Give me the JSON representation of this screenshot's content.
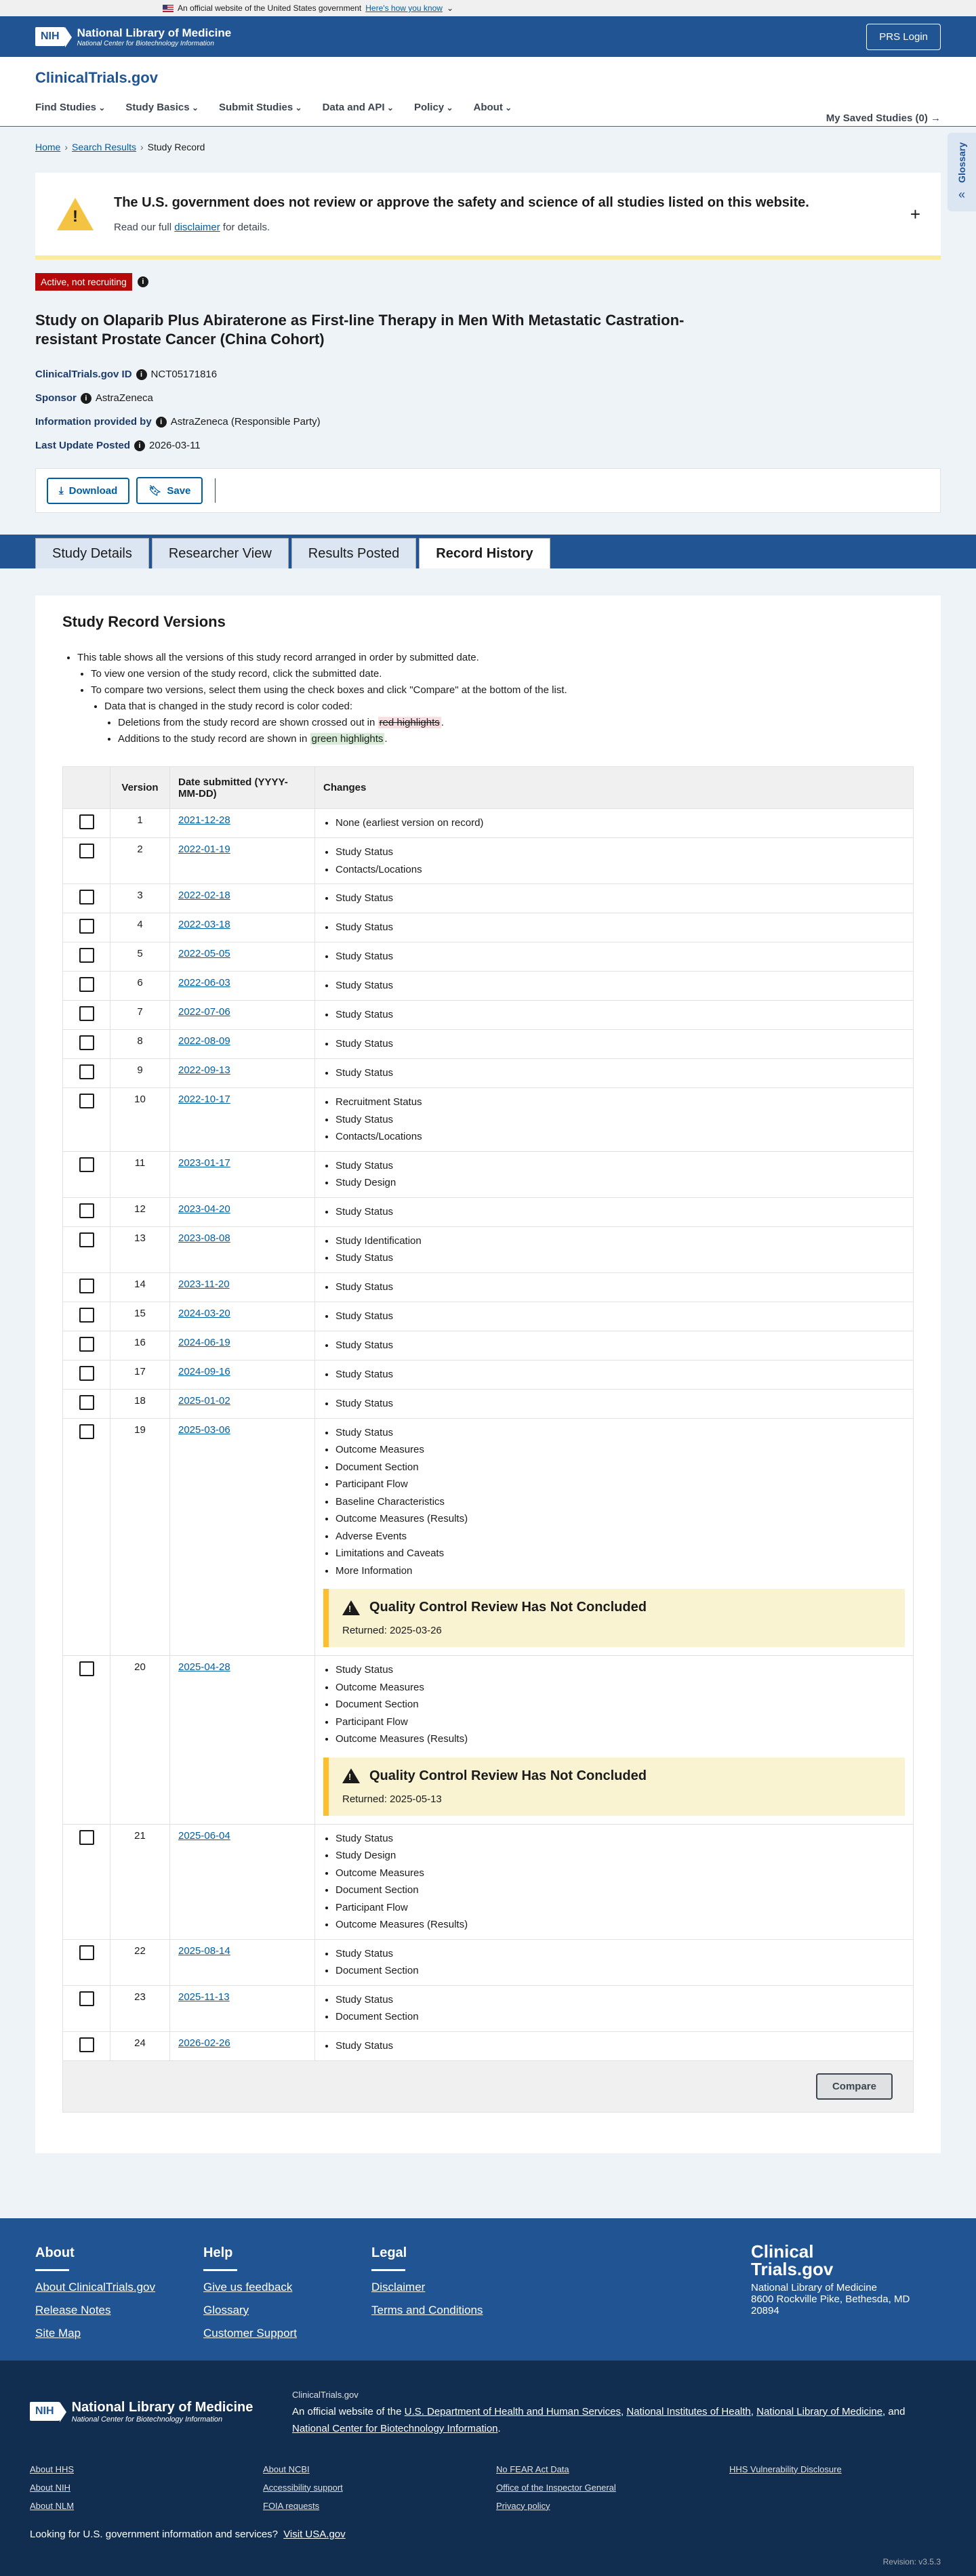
{
  "gov_banner": {
    "text": "An official website of the United States government",
    "link": "Here's how you know"
  },
  "nlm": {
    "nih": "NIH",
    "title": "National Library of Medicine",
    "subtitle": "National Center for Biotechnology Information",
    "prs_login": "PRS Login"
  },
  "site": {
    "logo_main": "ClinicalTrials",
    "logo_suffix": ".gov"
  },
  "nav": {
    "items": [
      "Find Studies",
      "Study Basics",
      "Submit Studies",
      "Data and API",
      "Policy",
      "About"
    ],
    "saved": "My Saved Studies (0)"
  },
  "breadcrumb": {
    "home": "Home",
    "search": "Search Results",
    "current": "Study Record"
  },
  "glossary": {
    "label": "Glossary"
  },
  "alert": {
    "title": "The U.S. government does not review or approve the safety and science of all studies listed on this website.",
    "body_prefix": "Read our full",
    "body_link": "disclaimer",
    "body_suffix": "for details."
  },
  "status": {
    "badge": "Active, not recruiting"
  },
  "study": {
    "title": "Study on Olaparib Plus Abiraterone as First-line Therapy in Men With Metastatic Castration-resistant Prostate Cancer (China Cohort)",
    "id_label": "ClinicalTrials.gov ID",
    "id": "NCT05171816",
    "sponsor_label": "Sponsor",
    "sponsor": "AstraZeneca",
    "provided_label": "Information provided by",
    "provided": "AstraZeneca (Responsible Party)",
    "updated_label": "Last Update Posted",
    "updated": "2026-03-11"
  },
  "actions": {
    "download": "Download",
    "save": "Save"
  },
  "tabs": [
    {
      "label": "Study Details",
      "active": false
    },
    {
      "label": "Researcher View",
      "active": false
    },
    {
      "label": "Results Posted",
      "active": false
    },
    {
      "label": "Record History",
      "active": true
    }
  ],
  "versions": {
    "heading": "Study Record Versions",
    "intro": "This table shows all the versions of this study record arranged in order by submitted date.",
    "view_one": "To view one version of the study record, click the submitted date.",
    "compare": "To compare two versions, select them using the check boxes and click \"Compare\" at the bottom of the list.",
    "color_coded": "Data that is changed in the study record is color coded:",
    "deletions_prefix": "Deletions from the study record are shown crossed out in",
    "deletions_mark": "red highlights",
    "additions_prefix": "Additions to the study record are shown in",
    "additions_mark": "green highlights",
    "col_version": "Version",
    "col_date": "Date submitted (YYYY-MM-DD)",
    "col_changes": "Changes",
    "compare_button": "Compare",
    "rows": [
      {
        "version": "1",
        "date": "2021-12-28",
        "changes": [
          "None (earliest version on record)"
        ],
        "plain": true
      },
      {
        "version": "2",
        "date": "2022-01-19",
        "changes": [
          "Study Status",
          "Contacts/Locations"
        ]
      },
      {
        "version": "3",
        "date": "2022-02-18",
        "changes": [
          "Study Status"
        ]
      },
      {
        "version": "4",
        "date": "2022-03-18",
        "changes": [
          "Study Status"
        ]
      },
      {
        "version": "5",
        "date": "2022-05-05",
        "changes": [
          "Study Status"
        ]
      },
      {
        "version": "6",
        "date": "2022-06-03",
        "changes": [
          "Study Status"
        ]
      },
      {
        "version": "7",
        "date": "2022-07-06",
        "changes": [
          "Study Status"
        ]
      },
      {
        "version": "8",
        "date": "2022-08-09",
        "changes": [
          "Study Status"
        ]
      },
      {
        "version": "9",
        "date": "2022-09-13",
        "changes": [
          "Study Status"
        ]
      },
      {
        "version": "10",
        "date": "2022-10-17",
        "changes": [
          "Recruitment Status",
          "Study Status",
          "Contacts/Locations"
        ]
      },
      {
        "version": "11",
        "date": "2023-01-17",
        "changes": [
          "Study Status",
          "Study Design"
        ]
      },
      {
        "version": "12",
        "date": "2023-04-20",
        "changes": [
          "Study Status"
        ]
      },
      {
        "version": "13",
        "date": "2023-08-08",
        "changes": [
          "Study Identification",
          "Study Status"
        ]
      },
      {
        "version": "14",
        "date": "2023-11-20",
        "changes": [
          "Study Status"
        ]
      },
      {
        "version": "15",
        "date": "2024-03-20",
        "changes": [
          "Study Status"
        ]
      },
      {
        "version": "16",
        "date": "2024-06-19",
        "changes": [
          "Study Status"
        ]
      },
      {
        "version": "17",
        "date": "2024-09-16",
        "changes": [
          "Study Status"
        ]
      },
      {
        "version": "18",
        "date": "2025-01-02",
        "changes": [
          "Study Status"
        ]
      },
      {
        "version": "19",
        "date": "2025-03-06",
        "changes": [
          "Study Status",
          "Outcome Measures",
          "Document Section",
          "Participant Flow",
          "Baseline Characteristics",
          "Outcome Measures (Results)",
          "Adverse Events",
          "Limitations and Caveats",
          "More Information"
        ],
        "qc": {
          "title": "Quality Control Review Has Not Concluded",
          "returned": "Returned: 2025-03-26"
        }
      },
      {
        "version": "20",
        "date": "2025-04-28",
        "changes": [
          "Study Status",
          "Outcome Measures",
          "Document Section",
          "Participant Flow",
          "Outcome Measures (Results)"
        ],
        "qc": {
          "title": "Quality Control Review Has Not Concluded",
          "returned": "Returned: 2025-05-13"
        }
      },
      {
        "version": "21",
        "date": "2025-06-04",
        "changes": [
          "Study Status",
          "Study Design",
          "Outcome Measures",
          "Document Section",
          "Participant Flow",
          "Outcome Measures (Results)"
        ]
      },
      {
        "version": "22",
        "date": "2025-08-14",
        "changes": [
          "Study Status",
          "Document Section"
        ]
      },
      {
        "version": "23",
        "date": "2025-11-13",
        "changes": [
          "Study Status",
          "Document Section"
        ]
      },
      {
        "version": "24",
        "date": "2026-02-26",
        "changes": [
          "Study Status"
        ]
      }
    ]
  },
  "footer": {
    "about": {
      "heading": "About",
      "links": [
        "About ClinicalTrials.gov",
        "Release Notes",
        "Site Map"
      ]
    },
    "help": {
      "heading": "Help",
      "links": [
        "Give us feedback",
        "Glossary",
        "Customer Support"
      ]
    },
    "legal": {
      "heading": "Legal",
      "links": [
        "Disclaimer",
        "Terms and Conditions"
      ]
    },
    "brand_line1": "Clinical",
    "brand_line2": "Trials.gov",
    "address_line1": "National Library of Medicine",
    "address_line2": "8600 Rockville Pike, Bethesda, MD 20894"
  },
  "footer_nlm": {
    "nih": "NIH",
    "title": "National Library of Medicine",
    "subtitle": "National Center for Biotechnology Information",
    "site": "ClinicalTrials.gov",
    "official_prefix": "An official website of the",
    "hhs": "U.S. Department of Health and Human Services",
    "nih_link": "National Institutes of Health",
    "nlm_link": "National Library of Medicine",
    "ncbi_link": "National Center for Biotechnology Information",
    "and": "and",
    "links": [
      "About HHS",
      "About NCBI",
      "No FEAR Act Data",
      "HHS Vulnerability Disclosure",
      "About NIH",
      "Accessibility support",
      "Office of the Inspector General",
      "",
      "About NLM",
      "FOIA requests",
      "Privacy policy",
      ""
    ],
    "usa_prefix": "Looking for U.S. government information and services?",
    "usa_link": "Visit USA.gov",
    "revision": "Revision: v3.5.3"
  }
}
